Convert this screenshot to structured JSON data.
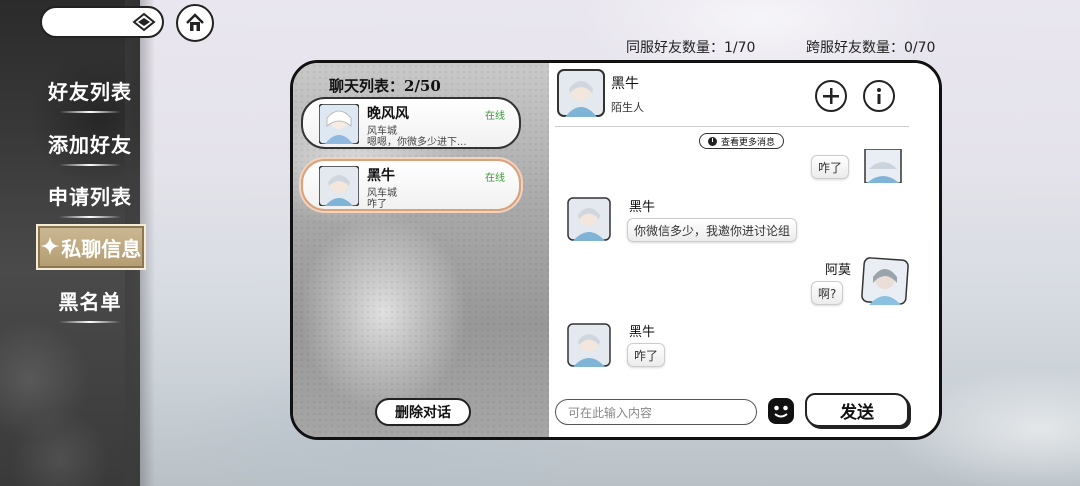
{
  "sidebar": {
    "items": [
      {
        "label": "好友列表"
      },
      {
        "label": "添加好友"
      },
      {
        "label": "申请列表"
      },
      {
        "label": "私聊信息",
        "active": true
      },
      {
        "label": "黑名单"
      }
    ]
  },
  "header": {
    "same_server_label": "同服好友数量：",
    "same_server_value": "1/70",
    "cross_server_label": "跨服好友数量：",
    "cross_server_value": "0/70"
  },
  "chat_list": {
    "title": "聊天列表：2/50",
    "items": [
      {
        "name": "晚风风",
        "location": "风车城",
        "last_message": "嗯嗯，你微多少进下...",
        "status": "在线"
      },
      {
        "name": "黑牛",
        "location": "风车城",
        "last_message": "咋了",
        "status": "在线",
        "selected": true
      }
    ],
    "delete_label": "删除对话"
  },
  "conversation": {
    "contact_name": "黑牛",
    "contact_relation": "陌生人",
    "view_more_label": "查看更多消息",
    "messages": [
      {
        "sender": "",
        "side": "right",
        "text": "咋了"
      },
      {
        "sender": "黑牛",
        "side": "left",
        "text": "你微信多少，我邀你进讨论组"
      },
      {
        "sender": "阿莫",
        "side": "right",
        "text": "啊?"
      },
      {
        "sender": "黑牛",
        "side": "left",
        "text": "咋了"
      }
    ],
    "input_placeholder": "可在此输入内容",
    "send_label": "发送"
  },
  "icons": {
    "search": "eye-search-icon",
    "home": "home-icon",
    "add": "plus-icon",
    "info": "info-icon",
    "emoji": "smiley-icon",
    "history": "clock-icon"
  },
  "colors": {
    "online": "#3a9a3a",
    "active_tab": "#c4ad84",
    "selected_border": "#d7a27c"
  }
}
